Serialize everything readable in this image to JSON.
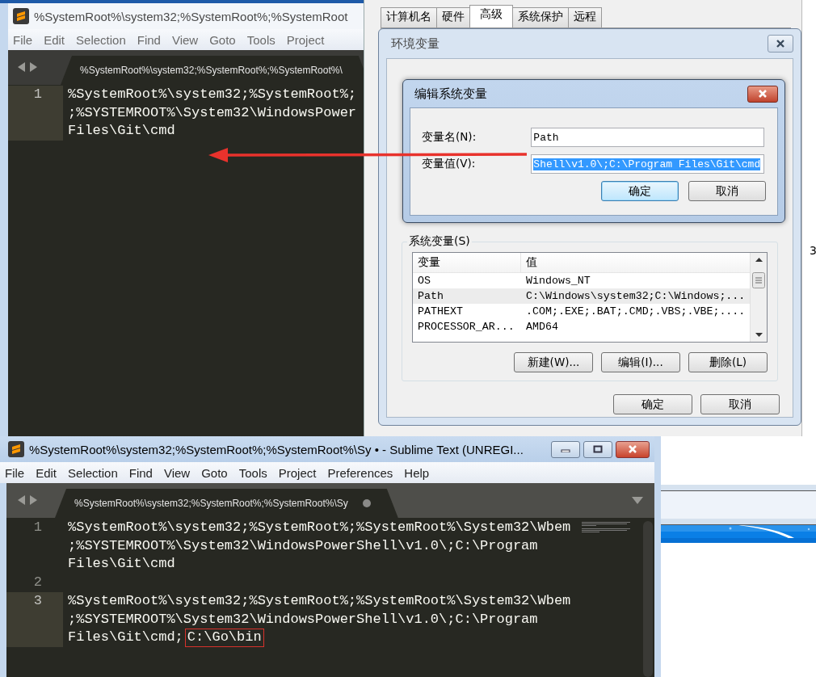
{
  "top_editor": {
    "title": "%SystemRoot%\\system32;%SystemRoot%;%SystemRoot",
    "active": false,
    "menu": [
      "File",
      "Edit",
      "Selection",
      "Find",
      "View",
      "Goto",
      "Tools",
      "Project"
    ],
    "tab": {
      "label": "%SystemRoot%\\system32;%SystemRoot%;%SystemRoot%\\"
    },
    "lines": [
      {
        "number": "1",
        "current": true,
        "text": [
          "%SystemRoot%\\system32;%SystemRoot%;",
          ";%SYSTEMROOT%\\System32\\WindowsPower",
          "Files\\Git\\cmd"
        ]
      }
    ]
  },
  "system_properties": {
    "tabs": [
      {
        "label": "计算机名",
        "selected": false
      },
      {
        "label": "硬件",
        "selected": false
      },
      {
        "label": "高级",
        "selected": true
      },
      {
        "label": "系统保护",
        "selected": false
      },
      {
        "label": "远程",
        "selected": false
      }
    ]
  },
  "right_window": {
    "text": "3"
  },
  "env_dialog": {
    "title": "环境变量",
    "group_label": "系统变量(S)",
    "columns": [
      "变量",
      "值"
    ],
    "rows": [
      {
        "name": "OS",
        "value": "Windows_NT",
        "selected": false
      },
      {
        "name": "Path",
        "value": "C:\\Windows\\system32;C:\\Windows;...",
        "selected": true
      },
      {
        "name": "PATHEXT",
        "value": ".COM;.EXE;.BAT;.CMD;.VBS;.VBE;....",
        "selected": false
      },
      {
        "name": "PROCESSOR_AR...",
        "value": "AMD64",
        "selected": false
      }
    ],
    "buttons": [
      "新建(W)...",
      "编辑(I)...",
      "删除(L)"
    ],
    "footer_buttons": [
      {
        "label": "确定",
        "default": false
      },
      {
        "label": "取消",
        "default": false
      }
    ]
  },
  "edit_dialog": {
    "title": "编辑系统变量",
    "fields": [
      {
        "label": "变量名(N):",
        "value": "Path",
        "selected": false
      },
      {
        "label": "变量值(V):",
        "value": "Shell\\v1.0\\;C:\\Program Files\\Git\\cmd",
        "selected": true
      }
    ],
    "buttons": [
      {
        "label": "确定",
        "default": true
      },
      {
        "label": "取消",
        "default": false
      }
    ]
  },
  "bottom_editor": {
    "title": "%SystemRoot%\\system32;%SystemRoot%;%SystemRoot%\\Sy • - Sublime Text (UNREGI...",
    "active": true,
    "window_controls": true,
    "menu": [
      "File",
      "Edit",
      "Selection",
      "Find",
      "View",
      "Goto",
      "Tools",
      "Project",
      "Preferences",
      "Help"
    ],
    "tab": {
      "label": "%SystemRoot%\\system32;%SystemRoot%;%SystemRoot%\\Sy",
      "dirty": true
    },
    "lines": [
      {
        "number": "1",
        "current": false,
        "text": [
          "%SystemRoot%\\system32;%SystemRoot%;%SystemRoot%\\System32\\Wbem",
          ";%SYSTEMROOT%\\System32\\WindowsPowerShell\\v1.0\\;C:\\Program",
          "Files\\Git\\cmd"
        ]
      },
      {
        "number": "2",
        "current": false
      },
      {
        "number": "3",
        "current": true,
        "text": [
          "%SystemRoot%\\system32;%SystemRoot%;%SystemRoot%\\System32\\Wbem",
          ";%SYSTEMROOT%\\System32\\WindowsPowerShell\\v1.0\\;C:\\Program",
          "Files\\Git\\cmd;"
        ],
        "boxed": "C:\\Go\\bin"
      }
    ]
  }
}
